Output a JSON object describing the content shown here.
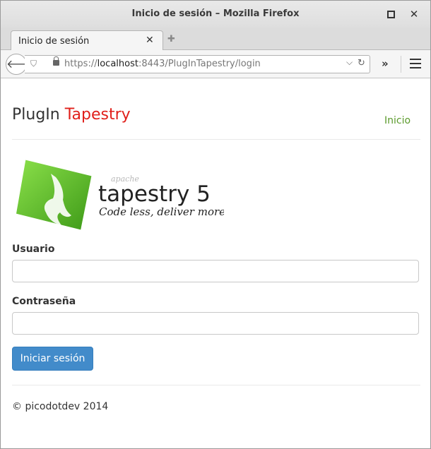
{
  "window": {
    "title": "Inicio de sesión – Mozilla Firefox"
  },
  "tabs": [
    {
      "label": "Inicio de sesión",
      "active": true
    }
  ],
  "navbar": {
    "url_scheme": "https://",
    "url_host": "localhost",
    "url_rest": ":8443/PlugInTapestry/login"
  },
  "page": {
    "brand_part1": "PlugIn ",
    "brand_part2": "Tapestry",
    "nav_home": "Inicio",
    "logo": {
      "apache": "apache",
      "name": "tapestry 5",
      "tagline": "Code less, deliver more."
    },
    "form": {
      "username_label": "Usuario",
      "username_value": "",
      "password_label": "Contraseña",
      "password_value": "",
      "submit_label": "Iniciar sesión"
    },
    "footer": "© picodotdev 2014"
  },
  "colors": {
    "brand_accent": "#e0201b",
    "link": "#5b9a2c",
    "primary_button": "#428bca",
    "logo_green": "#5fbf2a"
  },
  "icons": [
    "back-arrow-icon",
    "shield-icon",
    "lock-icon",
    "dropdown-icon",
    "reload-icon",
    "overflow-icon",
    "hamburger-menu-icon",
    "new-tab-icon",
    "close-tab-icon"
  ]
}
